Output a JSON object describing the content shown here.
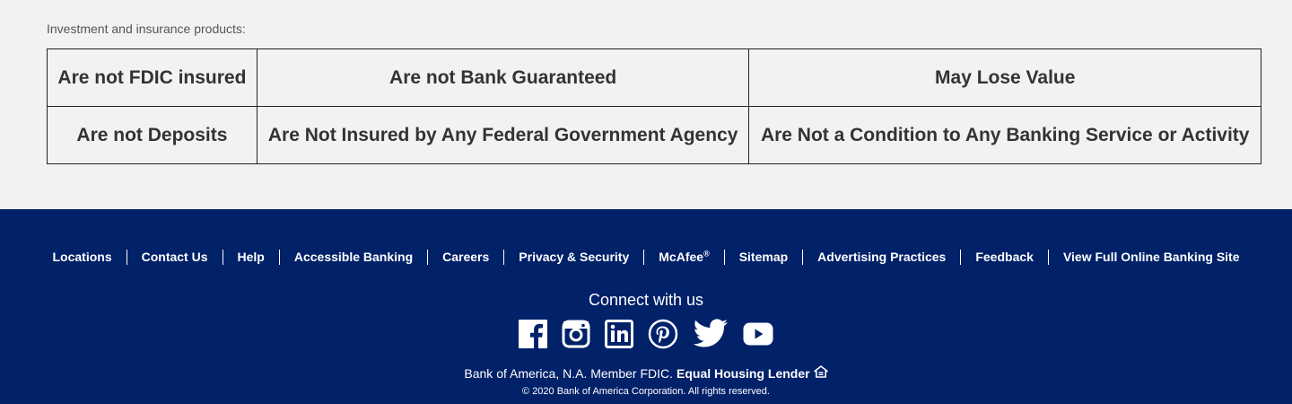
{
  "disclosure": {
    "intro": "Investment and insurance products:",
    "rows": [
      [
        "Are not FDIC insured",
        "Are not Bank Guaranteed",
        "May Lose Value"
      ],
      [
        "Are not Deposits",
        "Are Not Insured by Any Federal Government Agency",
        "Are Not a Condition to Any Banking Service or Activity"
      ]
    ]
  },
  "footer": {
    "links": [
      {
        "label": "Locations"
      },
      {
        "label": "Contact Us"
      },
      {
        "label": "Help"
      },
      {
        "label": "Accessible Banking"
      },
      {
        "label": "Careers"
      },
      {
        "label": "Privacy & Security"
      },
      {
        "label": "McAfee",
        "sup": "®"
      },
      {
        "label": "Sitemap"
      },
      {
        "label": "Advertising Practices"
      },
      {
        "label": "Feedback"
      },
      {
        "label": "View Full Online Banking Site"
      }
    ],
    "connect_title": "Connect with us",
    "social": [
      {
        "name": "facebook-icon"
      },
      {
        "name": "instagram-icon"
      },
      {
        "name": "linkedin-icon"
      },
      {
        "name": "pinterest-icon"
      },
      {
        "name": "twitter-icon"
      },
      {
        "name": "youtube-icon"
      }
    ],
    "member_text": "Bank of America, N.A. Member FDIC.",
    "equal_housing": "Equal Housing Lender",
    "equal_housing_icon": "house-icon",
    "copyright": "© 2020 Bank of America Corporation. All rights reserved."
  },
  "colors": {
    "footer_bg": "#012169",
    "page_bg": "#f2f2f2",
    "table_text": "#333333"
  }
}
